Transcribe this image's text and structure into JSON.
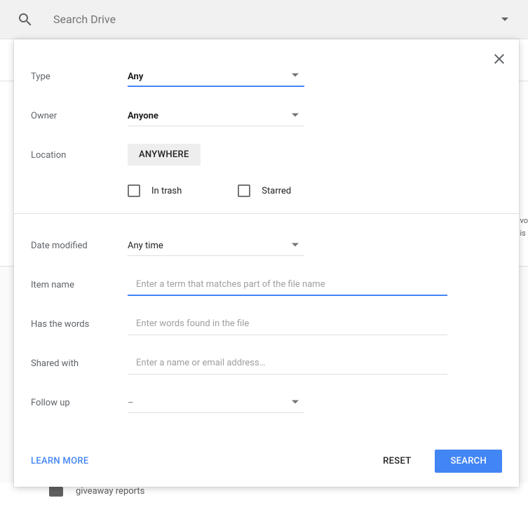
{
  "search": {
    "placeholder": "Search Drive"
  },
  "modal": {
    "labels": {
      "type": "Type",
      "owner": "Owner",
      "location": "Location",
      "date_modified": "Date modified",
      "item_name": "Item name",
      "has_words": "Has the words",
      "shared_with": "Shared with",
      "follow_up": "Follow up"
    },
    "values": {
      "type": "Any",
      "owner": "Anyone",
      "location_chip": "ANYWHERE",
      "in_trash": "In trash",
      "starred": "Starred",
      "date_modified": "Any time",
      "follow_up": "–"
    },
    "placeholders": {
      "item_name": "Enter a term that matches part of the file name",
      "has_words": "Enter words found in the file",
      "shared_with": "Enter a name or email address…"
    },
    "footer": {
      "learn_more": "LEARN MORE",
      "reset": "RESET",
      "search": "SEARCH"
    }
  },
  "background": {
    "folder_name": "giveaway reports"
  }
}
